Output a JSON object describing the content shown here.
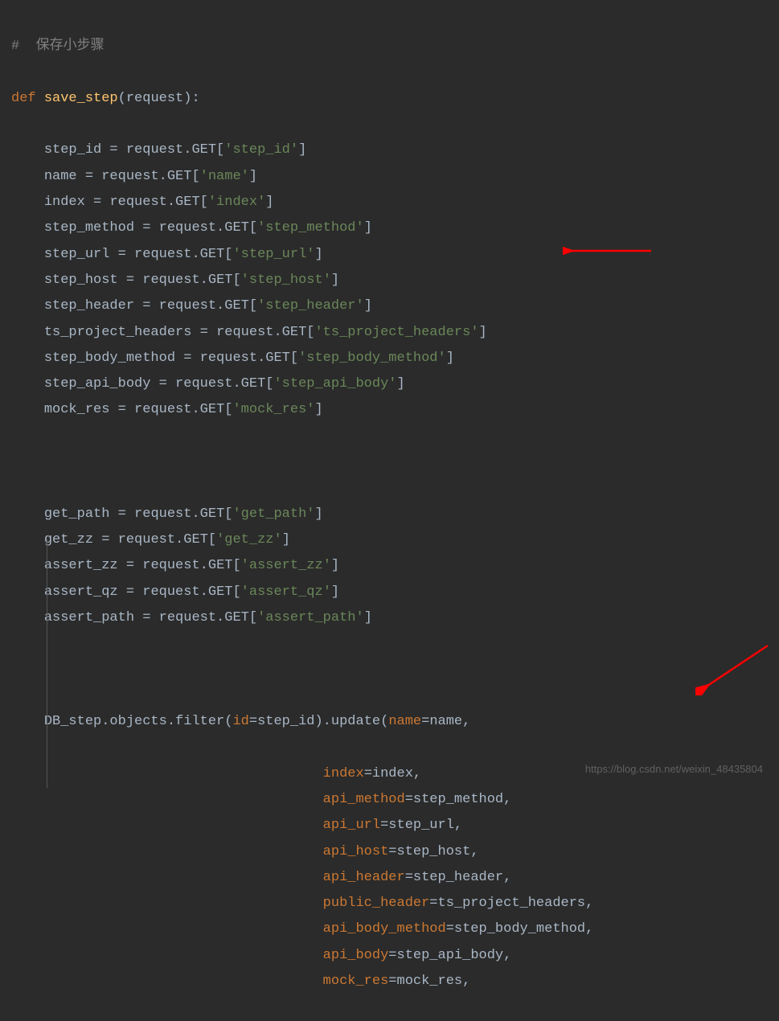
{
  "code": {
    "comment": "#  保存小步骤",
    "def_keyword": "def",
    "function_name": "save_step",
    "request_param": "request",
    "assignments": [
      {
        "var": "step_id",
        "key": "'step_id'"
      },
      {
        "var": "name",
        "key": "'name'"
      },
      {
        "var": "index",
        "key": "'index'"
      },
      {
        "var": "step_method",
        "key": "'step_method'"
      },
      {
        "var": "step_url",
        "key": "'step_url'"
      },
      {
        "var": "step_host",
        "key": "'step_host'"
      },
      {
        "var": "step_header",
        "key": "'step_header'"
      },
      {
        "var": "ts_project_headers",
        "key": "'ts_project_headers'"
      },
      {
        "var": "step_body_method",
        "key": "'step_body_method'"
      },
      {
        "var": "step_api_body",
        "key": "'step_api_body'"
      },
      {
        "var": "mock_res",
        "key": "'mock_res'"
      }
    ],
    "assignments2": [
      {
        "var": "get_path",
        "key": "'get_path'"
      },
      {
        "var": "get_zz",
        "key": "'get_zz'"
      },
      {
        "var": "assert_zz",
        "key": "'assert_zz'"
      },
      {
        "var": "assert_qz",
        "key": "'assert_qz'"
      },
      {
        "var": "assert_path",
        "key": "'assert_path'"
      }
    ],
    "request_get": "request.GET[",
    "equals": " = ",
    "close_bracket": "]",
    "db_call_prefix": "DB_step.objects.filter(",
    "id_param": "id",
    "step_id_val": "step_id",
    "update_call": ").update(",
    "update_params": [
      {
        "param": "name",
        "value": "name",
        "comma": ","
      },
      {
        "param": "index",
        "value": "index",
        "comma": ","
      },
      {
        "param": "api_method",
        "value": "step_method",
        "comma": ","
      },
      {
        "param": "api_url",
        "value": "step_url",
        "comma": ","
      },
      {
        "param": "api_host",
        "value": "step_host",
        "comma": ","
      },
      {
        "param": "api_header",
        "value": "step_header",
        "comma": ","
      },
      {
        "param": "public_header",
        "value": "ts_project_headers",
        "comma": ","
      },
      {
        "param": "api_body_method",
        "value": "step_body_method",
        "comma": ","
      },
      {
        "param": "api_body",
        "value": "step_api_body",
        "comma": ","
      },
      {
        "param": "mock_res",
        "value": "mock_res",
        "comma": ","
      }
    ],
    "indent_update": "                                  "
  },
  "watermark": "https://blog.csdn.net/weixin_48435804"
}
